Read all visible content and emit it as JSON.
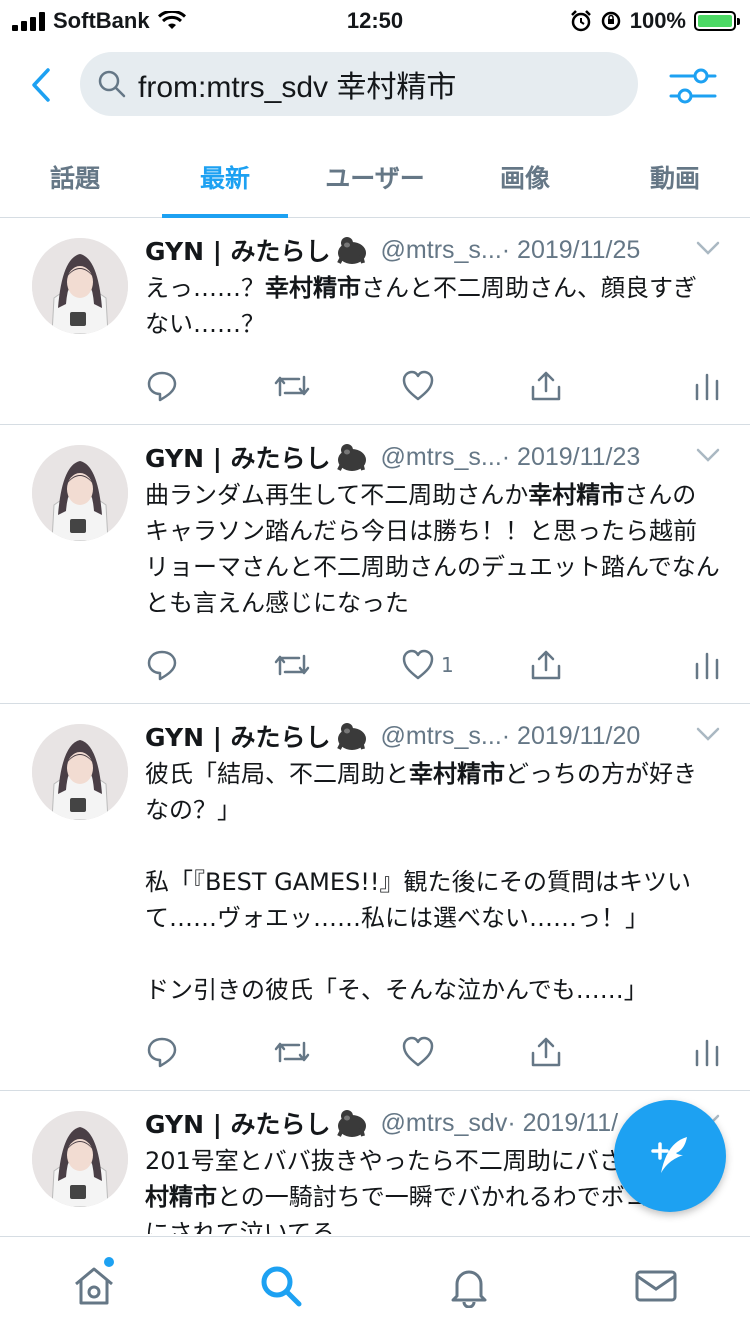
{
  "status_bar": {
    "carrier": "SoftBank",
    "time": "12:50",
    "battery": "100%"
  },
  "search": {
    "query": "from:mtrs_sdv 幸村精市"
  },
  "tabs": [
    {
      "label": "話題",
      "active": false
    },
    {
      "label": "最新",
      "active": true
    },
    {
      "label": "ユーザー",
      "active": false
    },
    {
      "label": "画像",
      "active": false
    },
    {
      "label": "動画",
      "active": false
    }
  ],
  "tweets": [
    {
      "name": "GYN | みたらし",
      "handle": "@mtrs_s...",
      "date": "· 2019/11/25",
      "text_parts": [
        {
          "t": "えっ……？",
          "b": false
        },
        {
          "t": "幸村精市",
          "b": true
        },
        {
          "t": "さんと不二周助さん、顔良すぎない……？",
          "b": false
        }
      ],
      "likes": ""
    },
    {
      "name": "GYN | みたらし",
      "handle": "@mtrs_s...",
      "date": "· 2019/11/23",
      "text_parts": [
        {
          "t": "曲ランダム再生して不二周助さんか",
          "b": false
        },
        {
          "t": "幸村精市",
          "b": true
        },
        {
          "t": "さんのキャラソン踏んだら今日は勝ち！！と思ったら越前リョーマさんと不二周助さんのデュエット踏んでなんとも言えん感じになった",
          "b": false
        }
      ],
      "likes": "1"
    },
    {
      "name": "GYN | みたらし",
      "handle": "@mtrs_s...",
      "date": "· 2019/11/20",
      "text_parts": [
        {
          "t": "彼氏「結局、不二周助と",
          "b": false
        },
        {
          "t": "幸村精市",
          "b": true
        },
        {
          "t": "どっちの方が好きなの？」\n\n私「『BEST GAMES!!』観た後にその質問はキツいて……ヴォエッ……私には選べない……っ！」\n\nドン引きの彼氏「そ、そんな泣かんでも……」",
          "b": false
        }
      ],
      "likes": ""
    },
    {
      "name": "GYN | みたらし",
      "handle": "@mtrs_sdv",
      "date": "· 2019/11/",
      "text_parts": [
        {
          "t": "201号室とババ抜きやったら不二周助にバ",
          "b": false
        },
        {
          "t": "されるわ",
          "b": false
        },
        {
          "t": "幸村精市",
          "b": true
        },
        {
          "t": "との一騎討ちで一瞬でバかれるわでボコボコにされて泣いてる",
          "b": false
        }
      ],
      "likes": ""
    }
  ],
  "icons": {
    "back": "chevron-left-icon",
    "filter": "sliders-icon",
    "reply": "reply-icon",
    "retweet": "retweet-icon",
    "like": "heart-icon",
    "share": "share-icon",
    "stats": "stats-icon",
    "compose": "compose-icon",
    "home": "home-icon",
    "search": "search-icon",
    "notifications": "bell-icon",
    "messages": "mail-icon"
  },
  "colors": {
    "accent": "#1da1f2",
    "muted": "#657786",
    "search_bg": "#e6ecf0"
  }
}
